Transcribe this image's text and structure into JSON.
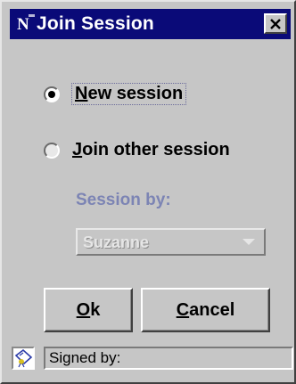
{
  "window": {
    "title": "Join Session"
  },
  "options": {
    "new_session": {
      "label_prefix": "",
      "label_mnemonic": "N",
      "label_rest": "ew session",
      "selected": true
    },
    "join_other": {
      "label_prefix": "",
      "label_mnemonic": "J",
      "label_rest": "oin other session",
      "selected": false
    }
  },
  "session": {
    "label": "Session by:",
    "selected_value": "Suzanne"
  },
  "buttons": {
    "ok": {
      "mnemonic": "O",
      "rest": "k"
    },
    "cancel": {
      "mnemonic": "C",
      "rest": "ancel"
    }
  },
  "status": {
    "text": "Signed by:"
  },
  "colors": {
    "titlebar": "#0a0a78",
    "window_bg": "#c6c6c6",
    "disabled_label": "#7c84b4"
  },
  "icons": {
    "app": "netscape-n-icon",
    "close": "close-icon",
    "combo_arrow": "chevron-down-icon",
    "status": "certificate-icon"
  }
}
